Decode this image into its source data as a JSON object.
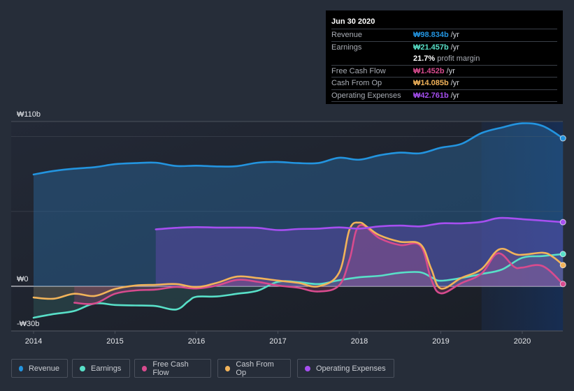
{
  "tooltip": {
    "date": "Jun 30 2020",
    "rows": [
      {
        "label": "Revenue",
        "value": "₩98.834b",
        "unit": "/yr",
        "color": "#2394df"
      },
      {
        "label": "Earnings",
        "value": "₩21.457b",
        "unit": "/yr",
        "color": "#58e0c8"
      },
      {
        "label": "",
        "value": "21.7%",
        "unit": "profit margin",
        "color": "#ffffff"
      },
      {
        "label": "Free Cash Flow",
        "value": "₩1.452b",
        "unit": "/yr",
        "color": "#d84b8e"
      },
      {
        "label": "Cash From Op",
        "value": "₩14.085b",
        "unit": "/yr",
        "color": "#f2b35a"
      },
      {
        "label": "Operating Expenses",
        "value": "₩42.761b",
        "unit": "/yr",
        "color": "#a64ff0"
      }
    ]
  },
  "legend": [
    {
      "label": "Revenue",
      "color": "#2394df"
    },
    {
      "label": "Earnings",
      "color": "#58e0c8"
    },
    {
      "label": "Free Cash Flow",
      "color": "#d84b8e"
    },
    {
      "label": "Cash From Op",
      "color": "#f2b35a"
    },
    {
      "label": "Operating Expenses",
      "color": "#a64ff0"
    }
  ],
  "chart_data": {
    "type": "line",
    "title": "",
    "xlabel": "",
    "ylabel": "",
    "ylim": [
      -30,
      110
    ],
    "xlim": [
      2014,
      2020.5
    ],
    "y_tick_labels": [
      {
        "value": 110,
        "label": "₩110b"
      },
      {
        "value": 0,
        "label": "₩0"
      },
      {
        "value": -30,
        "label": "-₩30b"
      }
    ],
    "gridlines": [
      110,
      100,
      50,
      0
    ],
    "x_ticks": [
      2014,
      2015,
      2016,
      2017,
      2018,
      2019,
      2020
    ],
    "x_tick_labels": [
      "2014",
      "2015",
      "2016",
      "2017",
      "2018",
      "2019",
      "2020"
    ],
    "highlight_range": [
      2019.5,
      2020.5
    ],
    "legend_position": "bottom",
    "series": [
      {
        "name": "Revenue",
        "color": "#2394df",
        "x": [
          2014.0,
          2014.25,
          2014.5,
          2014.75,
          2015.0,
          2015.25,
          2015.5,
          2015.75,
          2016.0,
          2016.25,
          2016.5,
          2016.75,
          2017.0,
          2017.25,
          2017.5,
          2017.75,
          2018.0,
          2018.25,
          2018.5,
          2018.75,
          2019.0,
          2019.25,
          2019.5,
          2019.75,
          2020.0,
          2020.25,
          2020.5
        ],
        "values": [
          74.6,
          77.0,
          78.5,
          79.5,
          81.5,
          82.2,
          82.5,
          80.3,
          80.5,
          80.0,
          80.2,
          82.5,
          83.0,
          82.2,
          82.3,
          85.8,
          84.5,
          87.5,
          89.2,
          88.8,
          92.5,
          95.0,
          102.3,
          106.0,
          108.8,
          107.0,
          98.8
        ]
      },
      {
        "name": "Earnings",
        "color": "#58e0c8",
        "x": [
          2014.0,
          2014.25,
          2014.5,
          2014.75,
          2015.0,
          2015.25,
          2015.5,
          2015.75,
          2015.9,
          2016.0,
          2016.25,
          2016.5,
          2016.75,
          2017.0,
          2017.25,
          2017.5,
          2017.75,
          2018.0,
          2018.25,
          2018.5,
          2018.75,
          2018.9,
          2019.0,
          2019.25,
          2019.5,
          2019.75,
          2020.0,
          2020.25,
          2020.5
        ],
        "values": [
          -21.0,
          -18.5,
          -16.5,
          -11.5,
          -12.5,
          -12.8,
          -13.2,
          -15.5,
          -10.0,
          -7.0,
          -6.8,
          -5.0,
          -3.0,
          3.0,
          2.8,
          1.5,
          4.0,
          6.0,
          7.0,
          9.0,
          9.3,
          5.5,
          3.7,
          5.5,
          8.2,
          11.2,
          19.0,
          20.2,
          21.5
        ]
      },
      {
        "name": "Free Cash Flow",
        "color": "#d84b8e",
        "x": [
          2014.5,
          2014.75,
          2015.0,
          2015.25,
          2015.5,
          2015.75,
          2016.0,
          2016.25,
          2016.5,
          2016.75,
          2017.0,
          2017.25,
          2017.5,
          2017.75,
          2017.88,
          2018.0,
          2018.25,
          2018.5,
          2018.75,
          2018.88,
          2019.0,
          2019.25,
          2019.5,
          2019.7,
          2019.9,
          2020.0,
          2020.25,
          2020.5
        ],
        "values": [
          -11.0,
          -11.5,
          -5.0,
          -2.8,
          -2.2,
          -0.5,
          -1.5,
          0.5,
          4.3,
          3.0,
          0.5,
          -1.0,
          -3.5,
          0.5,
          18.0,
          40.5,
          32.0,
          27.5,
          27.0,
          5.0,
          -4.7,
          2.0,
          8.5,
          22.0,
          13.0,
          12.5,
          13.5,
          1.5
        ]
      },
      {
        "name": "Cash From Op",
        "color": "#f2b35a",
        "x": [
          2014.0,
          2014.25,
          2014.5,
          2014.75,
          2015.0,
          2015.25,
          2015.5,
          2015.75,
          2016.0,
          2016.25,
          2016.5,
          2016.75,
          2017.0,
          2017.25,
          2017.5,
          2017.75,
          2017.88,
          2018.0,
          2018.1,
          2018.25,
          2018.5,
          2018.75,
          2018.88,
          2019.0,
          2019.25,
          2019.5,
          2019.72,
          2019.95,
          2020.25,
          2020.38,
          2020.5
        ],
        "values": [
          -7.5,
          -8.3,
          -5.0,
          -6.5,
          -1.8,
          0.5,
          1.0,
          1.5,
          -0.5,
          2.3,
          6.5,
          5.5,
          3.8,
          2.3,
          0.0,
          9.0,
          38.0,
          42.5,
          39.5,
          34.0,
          29.7,
          28.0,
          12.0,
          -1.5,
          5.5,
          11.5,
          24.7,
          21.0,
          22.4,
          19.5,
          14.1
        ]
      },
      {
        "name": "Operating Expenses",
        "color": "#a64ff0",
        "x": [
          2015.5,
          2015.75,
          2016.0,
          2016.25,
          2016.5,
          2016.75,
          2017.0,
          2017.25,
          2017.5,
          2017.75,
          2018.0,
          2018.25,
          2018.5,
          2018.75,
          2019.0,
          2019.25,
          2019.5,
          2019.72,
          2020.0,
          2020.25,
          2020.5
        ],
        "values": [
          38.0,
          39.0,
          39.5,
          39.2,
          39.2,
          39.0,
          37.5,
          38.2,
          38.5,
          39.3,
          38.5,
          40.0,
          40.5,
          40.0,
          42.0,
          42.0,
          43.0,
          45.6,
          44.8,
          43.8,
          42.8
        ]
      }
    ]
  }
}
